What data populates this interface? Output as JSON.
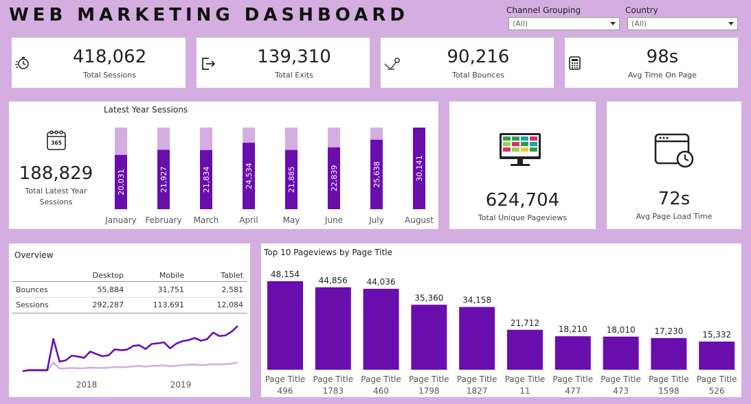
{
  "header": {
    "title": "WEB MARKETING DASHBOARD"
  },
  "filters": {
    "channel": {
      "label": "Channel Grouping",
      "value": "(All)"
    },
    "country": {
      "label": "Country",
      "value": "(All)"
    }
  },
  "kpis": {
    "sessions": {
      "value": "418,062",
      "label": "Total Sessions",
      "icon": "stopwatch-icon"
    },
    "exits": {
      "value": "139,310",
      "label": "Total Exits",
      "icon": "exit-icon"
    },
    "bounces": {
      "value": "90,216",
      "label": "Total Bounces",
      "icon": "bounce-icon"
    },
    "avg_time": {
      "value": "98s",
      "label": "Avg Time On Page",
      "icon": "calculator-icon"
    }
  },
  "latest_year": {
    "title": "Latest Year Sessions",
    "total_value": "188,829",
    "total_label_line1": "Total Latest Year",
    "total_label_line2": "Sessions",
    "icon_text": "365"
  },
  "unique_pageviews": {
    "value": "624,704",
    "label": "Total Unique Pageviews",
    "icon": "monitor-icon"
  },
  "page_load": {
    "value": "72s",
    "label": "Avg Page Load Time",
    "icon": "browser-clock-icon"
  },
  "overview": {
    "title": "Overview",
    "columns": [
      "Desktop",
      "Mobile",
      "Tablet"
    ],
    "rows": [
      {
        "label": "Bounces",
        "values": [
          "55,884",
          "31,751",
          "2,581"
        ]
      },
      {
        "label": "Sessions",
        "values": [
          "292,287",
          "113,691",
          "12,084"
        ]
      }
    ],
    "year_labels": [
      "2018",
      "2019"
    ]
  },
  "top10": {
    "title": "Top 10 Pageviews by Page Title"
  },
  "colors": {
    "primary": "#6a0dad",
    "light": "#d4aee0",
    "background": "#d4aee0"
  },
  "chart_data": [
    {
      "type": "bar",
      "title": "Latest Year Sessions",
      "categories": [
        "January",
        "February",
        "March",
        "April",
        "May",
        "June",
        "July",
        "August"
      ],
      "values": [
        20031,
        21927,
        21834,
        24534,
        21885,
        22839,
        25638,
        30141
      ],
      "value_labels": [
        "20,031",
        "21,927",
        "21,834",
        "24,534",
        "21,885",
        "22,839",
        "25,638",
        "30,141"
      ],
      "ylim": [
        0,
        30141
      ],
      "grid": false
    },
    {
      "type": "bar",
      "title": "Top 10 Pageviews by Page Title",
      "categories": [
        "Page Title 496",
        "Page Title 1783",
        "Page Title 460",
        "Page Title 1798",
        "Page Title 1827",
        "Page Title 11",
        "Page Title 477",
        "Page Title 473",
        "Page Title 1598",
        "Page Title 526"
      ],
      "category_lines": [
        [
          "Page Title",
          "496"
        ],
        [
          "Page Title",
          "1783"
        ],
        [
          "Page Title",
          "460"
        ],
        [
          "Page Title",
          "1798"
        ],
        [
          "Page Title",
          "1827"
        ],
        [
          "Page Title",
          "11"
        ],
        [
          "Page Title",
          "477"
        ],
        [
          "Page Title",
          "473"
        ],
        [
          "Page Title",
          "1598"
        ],
        [
          "Page Title",
          "526"
        ]
      ],
      "values": [
        48154,
        44856,
        44036,
        35360,
        34158,
        21712,
        18210,
        18010,
        17230,
        15332
      ],
      "value_labels": [
        "48,154",
        "44,856",
        "44,036",
        "35,360",
        "34,158",
        "21,712",
        "18,210",
        "18,010",
        "17,230",
        "15,332"
      ],
      "ylim": [
        0,
        48154
      ],
      "grid": false
    },
    {
      "type": "line",
      "title": "",
      "x_labels": [
        "2018",
        "2019"
      ],
      "series": [
        {
          "values": [
            3.3,
            3.6,
            3.6,
            3.6,
            3.6,
            13.5,
            6.3,
            6.7,
            8.2,
            7.9,
            7.5,
            9.5,
            8.7,
            8.0,
            8.3,
            10.2,
            9.9,
            10.1,
            11.3,
            11.5,
            10.3,
            11.9,
            12.1,
            12.4,
            10.5,
            12.0,
            12.8,
            13.1,
            13.8,
            12.9,
            13.4,
            15.5,
            14.4,
            14.6,
            15.8,
            17.6
          ]
        },
        {
          "values": [
            3.3,
            3.4,
            3.4,
            3.4,
            3.4,
            6.0,
            4.1,
            4.2,
            4.3,
            4.2,
            4.2,
            4.4,
            4.3,
            4.3,
            4.4,
            4.6,
            4.5,
            4.6,
            4.8,
            4.9,
            4.7,
            5.0,
            5.0,
            5.1,
            4.8,
            5.0,
            5.2,
            5.3,
            5.4,
            5.2,
            5.3,
            5.5,
            5.4,
            5.5,
            5.7,
            6.0
          ]
        }
      ],
      "grid": false
    }
  ]
}
